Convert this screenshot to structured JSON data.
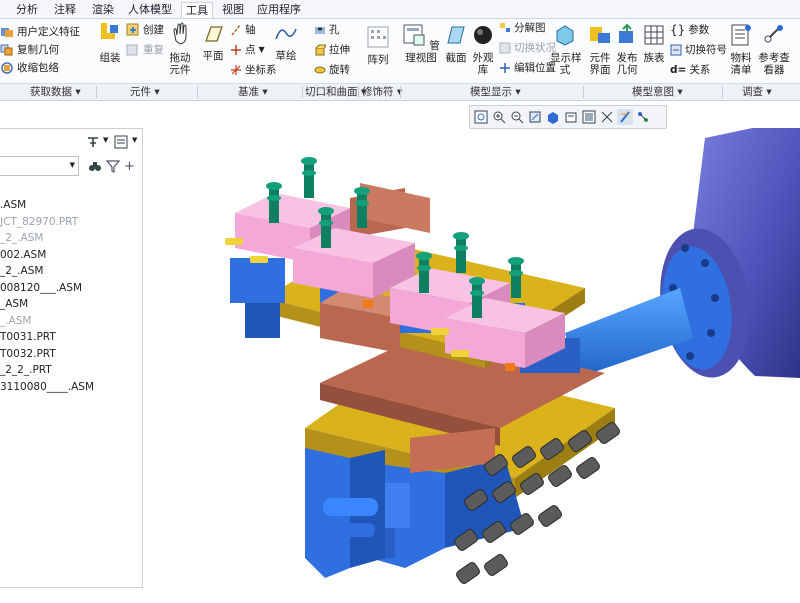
{
  "tabs": [
    "分析",
    "注释",
    "渲染",
    "人体模型",
    "工具",
    "视图",
    "应用程序"
  ],
  "active_tab": "工具",
  "ribbon": {
    "obtain": {
      "user_feature": "用户定义特征",
      "copy_geometry": "复制几何",
      "shrinkwrap": "收缩包络"
    },
    "component": {
      "assemble": "组装",
      "create": "创建",
      "repeat": "重复",
      "drag": "拖动\n元件"
    },
    "datum": {
      "plane": "平面",
      "axis": "轴",
      "point": "点",
      "csys": "坐标系",
      "sketch": "草绘"
    },
    "cut": {
      "hole": "孔",
      "extrude": "拉伸",
      "revolve": "旋转"
    },
    "modifier": {
      "pattern": "阵列"
    },
    "model_display": {
      "manage_views": "管理视图",
      "section": "截面",
      "appearance": "外观\n库",
      "explode": "分解图",
      "toggle_state": "切换状况",
      "edit_position": "编辑位置",
      "display_style": "显示样\n式"
    },
    "model_intent": {
      "component_interface": "元件\n界面",
      "publish_geometry": "发布\n几何",
      "family_table": "族表",
      "parameters": "参数",
      "switch_symbol": "切换符号",
      "relations": "关系"
    },
    "investigate": {
      "bom": "物料\n清单",
      "ref_viewer": "参考查\n看器"
    }
  },
  "groups": [
    "获取数据",
    "元件",
    "基准",
    "切口和曲面",
    "修饰符",
    "模型显示",
    "模型意图",
    "调查"
  ],
  "tree_items": [
    {
      "label": ".ASM",
      "dim": false
    },
    {
      "label": "JCT_82970.PRT",
      "dim": true
    },
    {
      "label": "_2_.ASM",
      "dim": true
    },
    {
      "label": "002.ASM",
      "dim": false
    },
    {
      "label": "_2_.ASM",
      "dim": false
    },
    {
      "label": "008120___.ASM",
      "dim": false
    },
    {
      "label": "_ASM",
      "dim": false
    },
    {
      "label": "_.ASM",
      "dim": true
    },
    {
      "label": "T0031.PRT",
      "dim": false
    },
    {
      "label": "T0032.PRT",
      "dim": false
    },
    {
      "label": "_2_2_.PRT",
      "dim": false
    },
    {
      "label": "3110080____.ASM",
      "dim": false
    }
  ],
  "colors": {
    "accent": "#2d6bd6",
    "part_blue": "#2f6fe0",
    "part_pink": "#f4a8d8",
    "part_yellow": "#d9b21c",
    "part_copper": "#b9674f",
    "part_green": "#13a07a",
    "robot_arm": "#4f54b3"
  }
}
